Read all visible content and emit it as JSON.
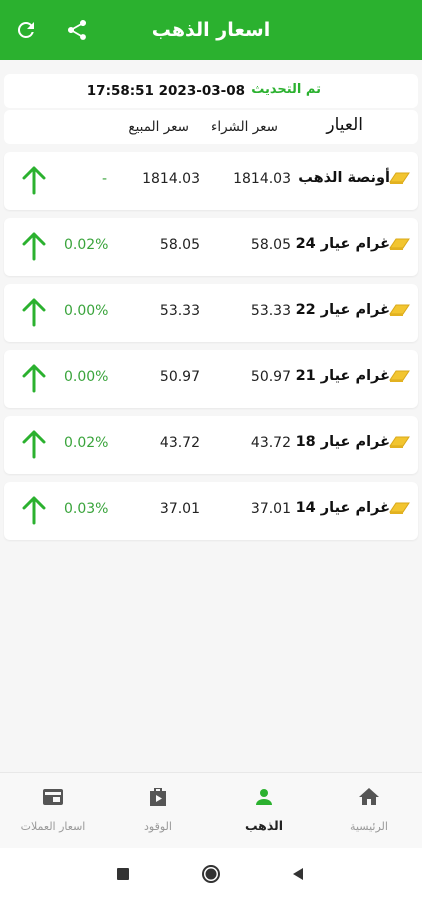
{
  "appbar": {
    "title": "اسعار الذهب",
    "icons": [
      "refresh-icon",
      "share-icon"
    ],
    "color": "#2bb12f"
  },
  "update": {
    "label": "تم التحديث",
    "timestamp": "17:58:51 2023-03-08"
  },
  "table": {
    "headers": {
      "karat": "العيار",
      "buy": "سعر الشراء",
      "sell": "سعر المبيع"
    },
    "rows": [
      {
        "name": "أونصة الذهب",
        "buy": "1814.03",
        "sell": "1814.03",
        "change": "-",
        "trend": "up"
      },
      {
        "name": "غرام عيار 24",
        "buy": "58.05",
        "sell": "58.05",
        "change": "0.02%",
        "trend": "up"
      },
      {
        "name": "غرام عيار 22",
        "buy": "53.33",
        "sell": "53.33",
        "change": "0.00%",
        "trend": "up"
      },
      {
        "name": "غرام عيار 21",
        "buy": "50.97",
        "sell": "50.97",
        "change": "0.00%",
        "trend": "up"
      },
      {
        "name": "غرام عيار 18",
        "buy": "43.72",
        "sell": "43.72",
        "change": "0.02%",
        "trend": "up"
      },
      {
        "name": "غرام عيار 14",
        "buy": "37.01",
        "sell": "37.01",
        "change": "0.03%",
        "trend": "up"
      }
    ]
  },
  "bottom_nav": {
    "items": [
      {
        "label": "اسعار العملات",
        "icon": "wallet-icon",
        "active": false
      },
      {
        "label": "الوقود",
        "icon": "fuel-bag-icon",
        "active": false
      },
      {
        "label": "الذهب",
        "icon": "person-icon",
        "active": true
      },
      {
        "label": "الرئيسية",
        "icon": "home-icon",
        "active": false
      }
    ]
  },
  "colors": {
    "accent": "#2bb12f",
    "up_arrow": "#2bb12f",
    "change_text": "#3aa43c",
    "gold": "#f2c530"
  }
}
